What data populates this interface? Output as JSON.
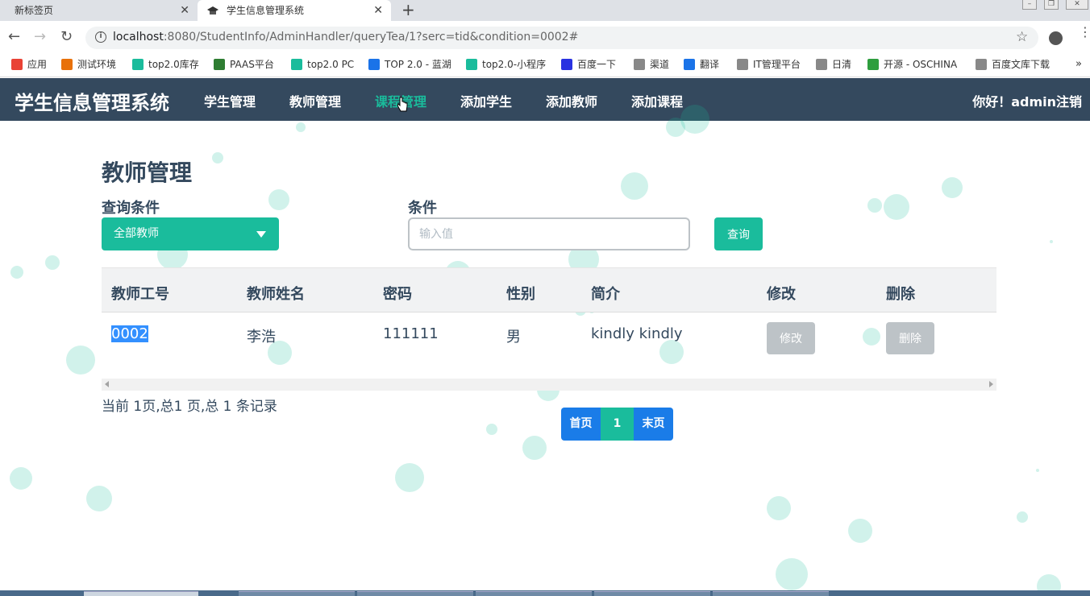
{
  "browser": {
    "tabs": [
      {
        "title": "新标签页"
      },
      {
        "title": "学生信息管理系统"
      }
    ],
    "url": {
      "host": "localhost",
      "rest": ":8080/StudentInfo/AdminHandler/queryTea/1?serc=tid&condition=0002#"
    },
    "bookmarks": [
      {
        "label": "应用",
        "color": "#e94235"
      },
      {
        "label": "测试环境",
        "color": "#e8710a"
      },
      {
        "label": "top2.0库存",
        "color": "#1abc9c"
      },
      {
        "label": "PAAS平台",
        "color": "#2e7d32"
      },
      {
        "label": "top2.0 PC",
        "color": "#1abc9c"
      },
      {
        "label": "TOP 2.0 - 蓝湖",
        "color": "#1a73e8"
      },
      {
        "label": "top2.0-小程序",
        "color": "#1abc9c"
      },
      {
        "label": "百度一下",
        "color": "#2932e1"
      },
      {
        "label": "渠道",
        "color": "#888888"
      },
      {
        "label": "翻译",
        "color": "#1a73e8"
      },
      {
        "label": "IT管理平台",
        "color": "#888888"
      },
      {
        "label": "日清",
        "color": "#888888"
      },
      {
        "label": "开源 - OSCHINA",
        "color": "#2e9e3e"
      },
      {
        "label": "百度文库下载",
        "color": "#888888"
      }
    ]
  },
  "app": {
    "brand": "学生信息管理系统",
    "nav": [
      "学生管理",
      "教师管理",
      "课程管理",
      "添加学生",
      "添加教师",
      "添加课程"
    ],
    "greeting": "你好！admin注销",
    "page_title": "教师管理",
    "filters": {
      "cond_label": "查询条件",
      "select_value": "全部教师",
      "value_label": "条件",
      "placeholder": "输入值",
      "query_button": "查询"
    },
    "table": {
      "headers": [
        "教师工号",
        "教师姓名",
        "密码",
        "性别",
        "简介",
        "修改",
        "删除"
      ],
      "rows": [
        {
          "id": "0002",
          "name": "李浩",
          "password": "111111",
          "gender": "男",
          "intro": "kindly kindly",
          "edit": "修改",
          "delete": "删除"
        }
      ]
    },
    "page_info": "当前 1页,总1 页,总 1 条记录",
    "pager": {
      "first": "首页",
      "current": "1",
      "last": "末页"
    }
  },
  "colors": {
    "nav_bg": "#34495e",
    "accent": "#1abc9c",
    "pager_blue": "#1a7ce8",
    "disabled_btn": "#bdc3c7"
  }
}
